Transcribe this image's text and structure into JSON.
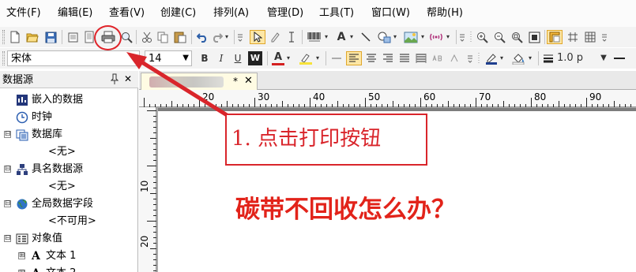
{
  "menu": {
    "items": [
      "文件(F)",
      "编辑(E)",
      "查看(V)",
      "创建(C)",
      "排列(A)",
      "管理(D)",
      "工具(T)",
      "窗口(W)",
      "帮助(H)"
    ]
  },
  "toolbar2": {
    "font_name": "宋体",
    "font_size": "14",
    "bold_label": "B",
    "italic_label": "I",
    "underline_label": "U",
    "word_label": "W",
    "font_color_label": "A",
    "line_width": "1.0 p"
  },
  "panel": {
    "title": "数据源",
    "pin": "ᵖ",
    "close": "✕",
    "items": [
      {
        "label": "嵌入的数据"
      },
      {
        "label": "时钟"
      },
      {
        "label": "数据库",
        "expander": "⊟"
      },
      {
        "label": "<无>"
      },
      {
        "label": "具名数据源",
        "expander": "⊟"
      },
      {
        "label": "<无>"
      },
      {
        "label": "全局数据字段",
        "expander": "⊟"
      },
      {
        "label": "<不可用>"
      },
      {
        "label": "对象值",
        "expander": "⊟"
      },
      {
        "label": "文本 1",
        "expander": "⊞"
      },
      {
        "label": "文本 2",
        "expander": "⊞"
      }
    ]
  },
  "doc": {
    "tab_modified": "*",
    "tab_close": "✕",
    "ruler_h": [
      "20",
      "30",
      "40",
      "50",
      "60",
      "70",
      "80",
      "90"
    ],
    "ruler_v": [
      "10",
      "20"
    ]
  },
  "annotation": {
    "text": "1. 点击打印按钮",
    "color": "#d9252b"
  },
  "headline": {
    "text": "碳带不回收怎么办？",
    "color": "#e2231a"
  }
}
